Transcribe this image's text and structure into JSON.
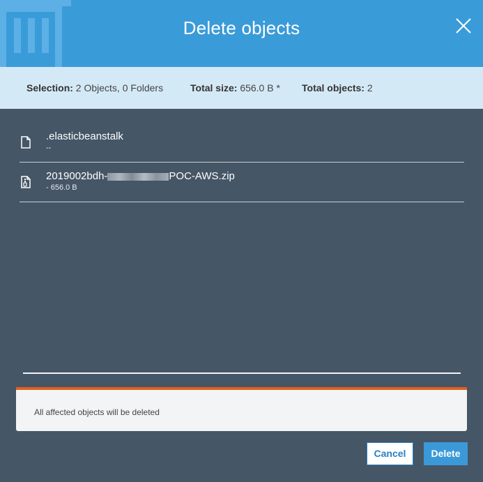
{
  "dialog": {
    "title": "Delete objects",
    "header_icon": "trash-icon",
    "close_icon": "close-icon"
  },
  "summary": {
    "selection_label": "Selection:",
    "selection_value": "2 Objects, 0 Folders",
    "size_label": "Total size:",
    "size_value": "656.0 B *",
    "total_label": "Total objects:",
    "total_value": "2"
  },
  "files": [
    {
      "name": ".elasticbeanstalk",
      "meta": "--",
      "icon": "file-icon"
    },
    {
      "name_prefix": "2019002bdh-",
      "name_suffix": "POC-AWS.zip",
      "meta": "- 656.0 B",
      "icon": "zip-file-icon"
    }
  ],
  "notice": {
    "message": "All affected objects will be deleted",
    "accent_color": "#e35f1f"
  },
  "actions": {
    "cancel_label": "Cancel",
    "delete_label": "Delete"
  },
  "colors": {
    "header": "#3a9bd9",
    "summary_bar": "#d4e9f6",
    "body": "#455666",
    "primary_button": "#3b99d8"
  }
}
